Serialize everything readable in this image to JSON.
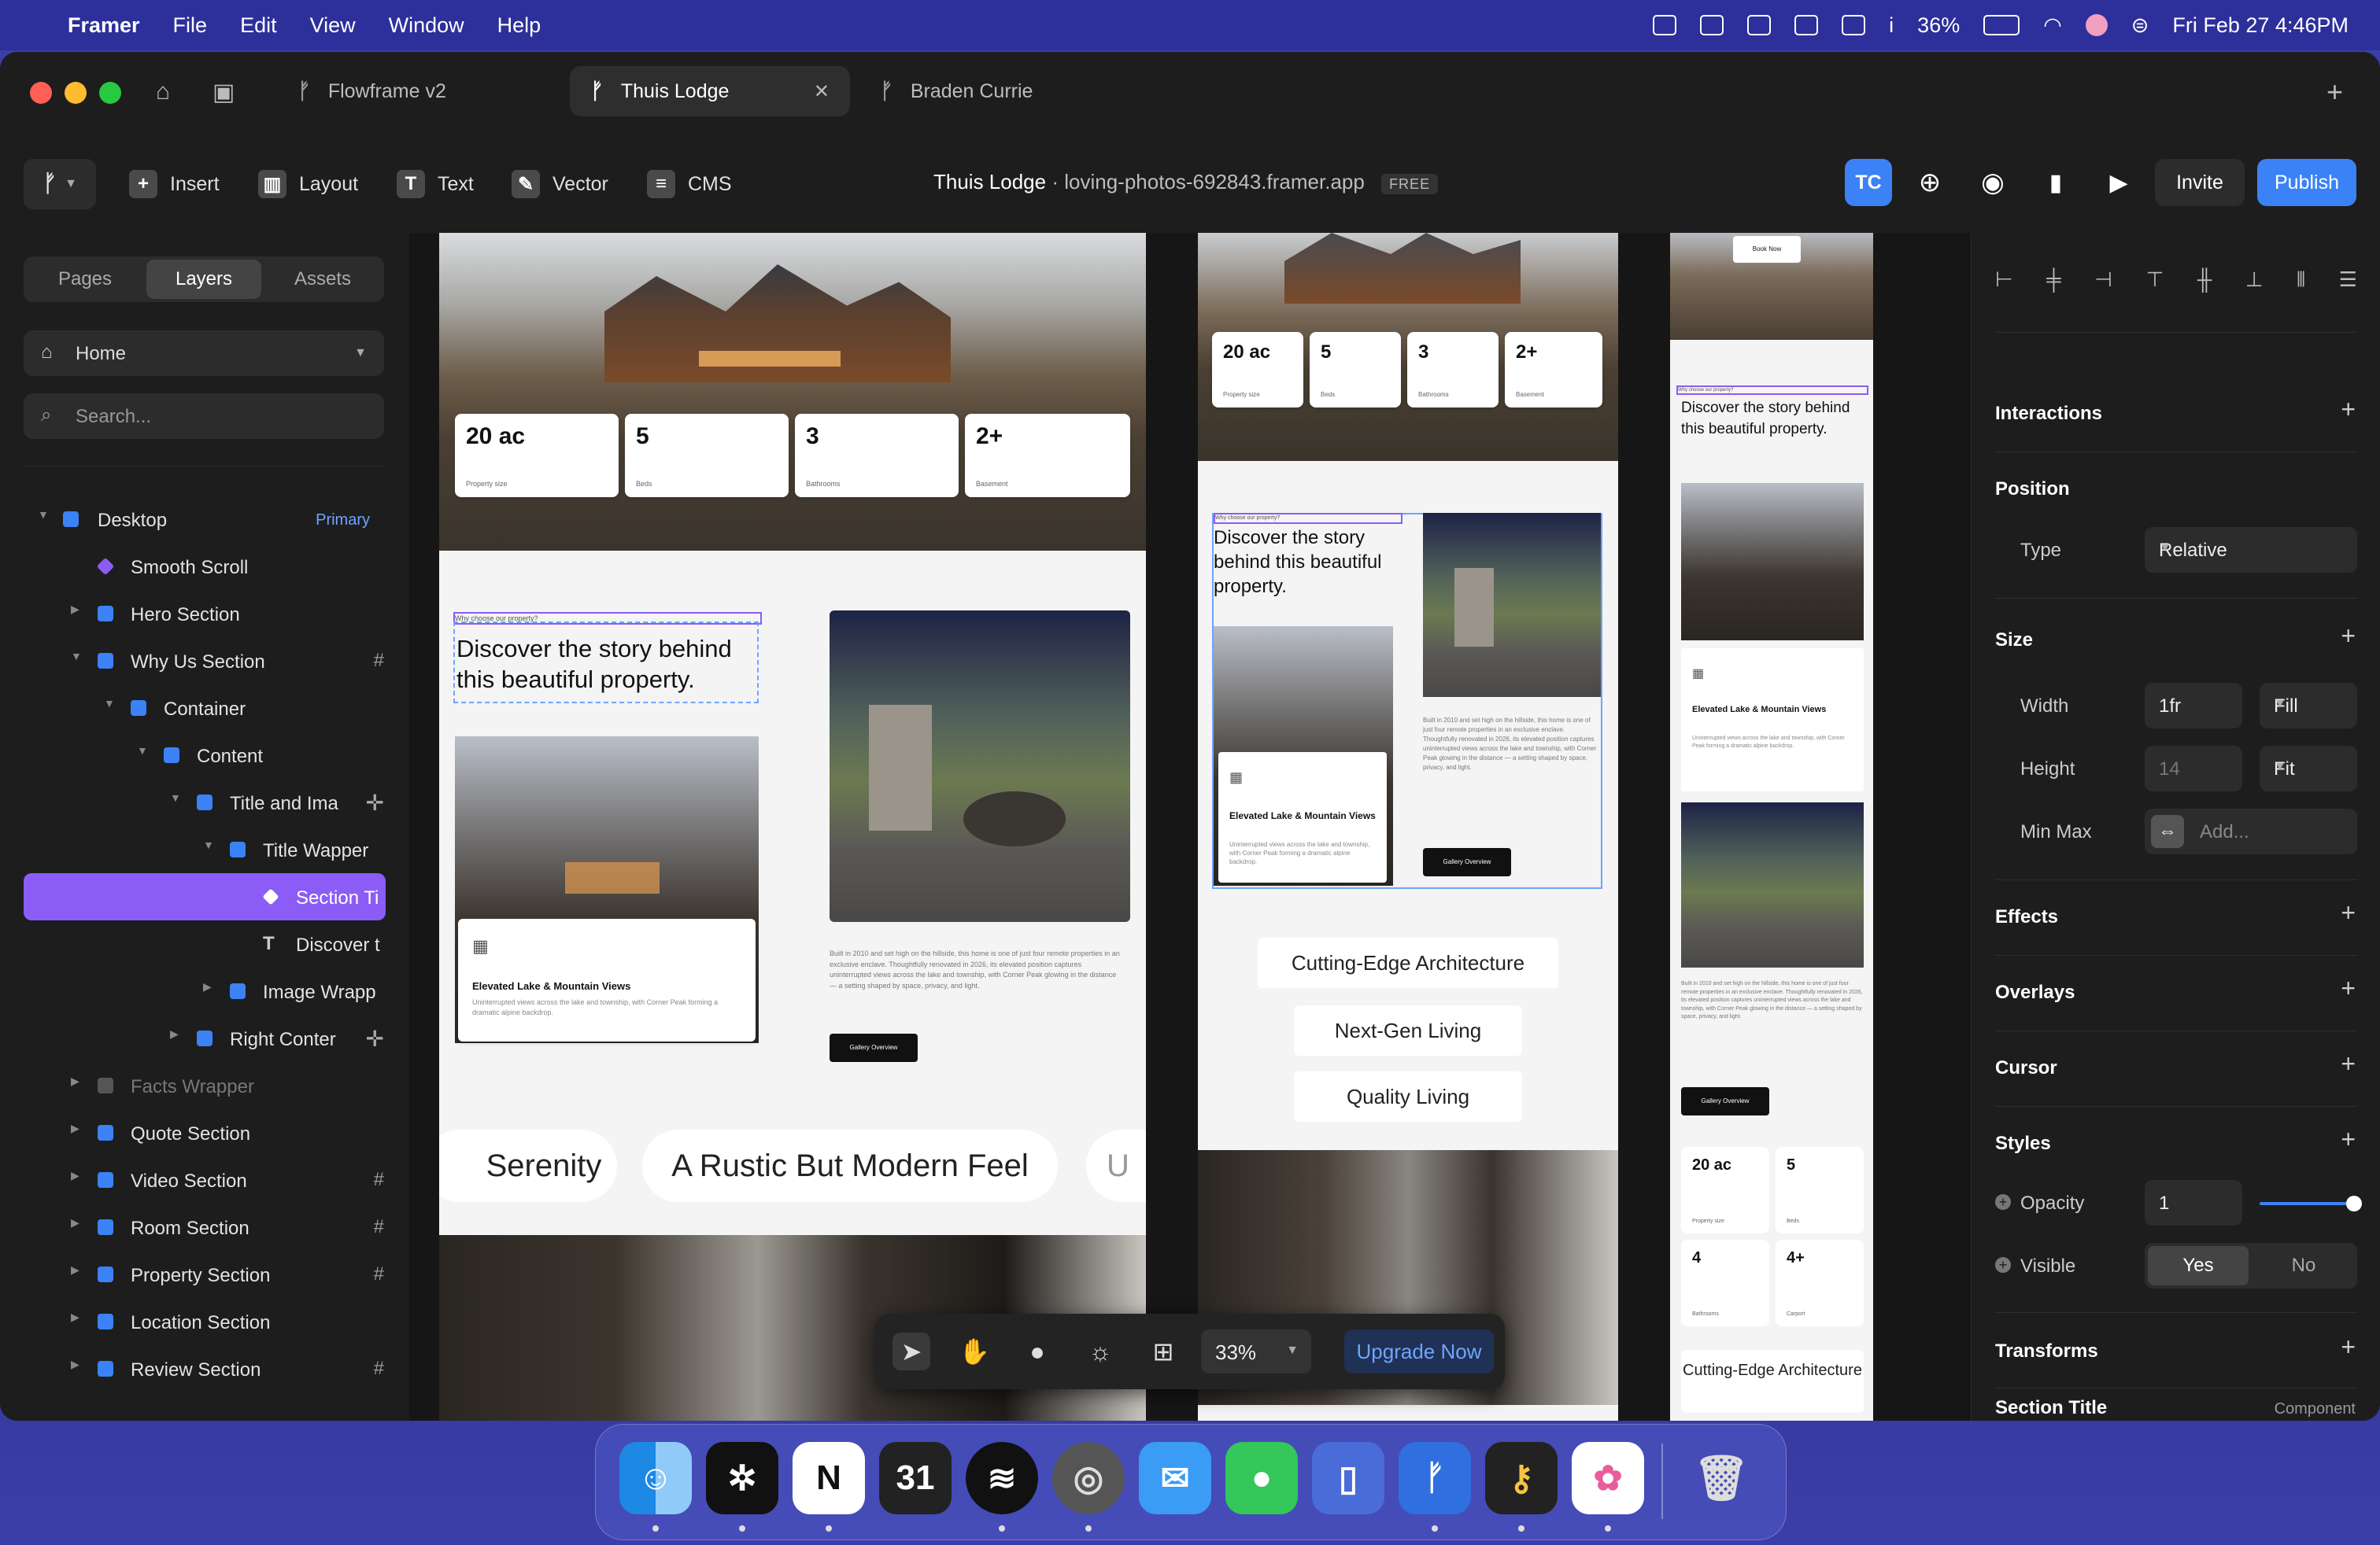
{
  "menubar": {
    "app": "Framer",
    "items": [
      "File",
      "Edit",
      "View",
      "Window",
      "Help"
    ],
    "battery": "36%",
    "datetime": "Fri Feb 27  4:46PM"
  },
  "tabs": [
    {
      "label": "Flowframe v2"
    },
    {
      "label": "Thuis Lodge"
    },
    {
      "label": "Braden Currie"
    }
  ],
  "toolbar": {
    "tools": [
      "Insert",
      "Layout",
      "Text",
      "Vector",
      "CMS"
    ],
    "project_name": "Thuis Lodge",
    "project_url": "loving-photos-692843.framer.app",
    "plan_badge": "FREE",
    "avatar_initials": "TC",
    "invite_label": "Invite",
    "publish_label": "Publish"
  },
  "left_panel": {
    "tabs": [
      "Pages",
      "Layers",
      "Assets"
    ],
    "page": "Home",
    "search_placeholder": "Search...",
    "primary_badge": "Primary",
    "layers": [
      {
        "label": "Desktop"
      },
      {
        "label": "Smooth Scroll"
      },
      {
        "label": "Hero Section"
      },
      {
        "label": "Why Us Section"
      },
      {
        "label": "Container"
      },
      {
        "label": "Content"
      },
      {
        "label": "Title and Ima"
      },
      {
        "label": "Title Wapper"
      },
      {
        "label": "Section Ti"
      },
      {
        "label": "Discover t"
      },
      {
        "label": "Image Wrapp"
      },
      {
        "label": "Right Conter"
      },
      {
        "label": "Facts Wrapper"
      },
      {
        "label": "Quote Section"
      },
      {
        "label": "Video Section"
      },
      {
        "label": "Room Section"
      },
      {
        "label": "Property Section"
      },
      {
        "label": "Location Section"
      },
      {
        "label": "Review Section"
      }
    ]
  },
  "right_panel": {
    "interactions": "Interactions",
    "position": "Position",
    "type_label": "Type",
    "type_value": "Relative",
    "size": "Size",
    "width_label": "Width",
    "width_value": "1fr",
    "width_mode": "Fill",
    "height_label": "Height",
    "height_value": "14",
    "height_mode": "Fit",
    "minmax_label": "Min Max",
    "minmax_placeholder": "Add...",
    "effects": "Effects",
    "overlays": "Overlays",
    "cursor": "Cursor",
    "styles": "Styles",
    "opacity_label": "Opacity",
    "opacity_value": "1",
    "visible_label": "Visible",
    "visible_yes": "Yes",
    "visible_no": "No",
    "transforms": "Transforms",
    "section_title": "Section Title",
    "component_label": "Component"
  },
  "site": {
    "stats_desktop": [
      {
        "num": "20 ac",
        "cap": "Property size"
      },
      {
        "num": "5",
        "cap": "Beds"
      },
      {
        "num": "3",
        "cap": "Bathrooms"
      },
      {
        "num": "2+",
        "cap": "Basement"
      }
    ],
    "stats_tablet": [
      {
        "num": "20 ac",
        "cap": "Property size"
      },
      {
        "num": "5",
        "cap": "Beds"
      },
      {
        "num": "3",
        "cap": "Bathrooms"
      },
      {
        "num": "2+",
        "cap": "Basement"
      }
    ],
    "stats_mobile": [
      {
        "num": "20 ac",
        "cap": "Property size"
      },
      {
        "num": "5",
        "cap": "Beds"
      },
      {
        "num": "4",
        "cap": "Bathrooms"
      },
      {
        "num": "4+",
        "cap": "Carport"
      }
    ],
    "eyebrow": "Why choose our property?",
    "heading": "Discover the story behind this beautiful property.",
    "card_title": "Elevated Lake & Mountain Views",
    "card_text": "Uninterrupted views across the lake and township, with Corner Peak forming a dramatic alpine backdrop.",
    "body_text": "Built in 2010 and set high on the hillside, this home is one of just four remote properties in an exclusive enclave. Thoughtfully renovated in 2026, its elevated position captures uninterrupted views across the lake and township, with Corner Peak glowing in the distance — a setting shaped by space, privacy, and light.",
    "gallery_button": "Gallery Overview",
    "book_now": "Book Now",
    "marquee": [
      "Serenity",
      "A Rustic But Modern Feel",
      "U"
    ],
    "tablet_pills": [
      "Cutting-Edge Architecture",
      "Next-Gen Living",
      "Quality Living"
    ],
    "mobile_pill": "Cutting-Edge Architecture"
  },
  "floatbar": {
    "zoom": "33%",
    "upgrade_label": "Upgrade Now"
  },
  "colors": {
    "accent_blue": "#3b82f6",
    "selection_purple": "#8b5cf6",
    "menubar": "#2d2f9a"
  }
}
